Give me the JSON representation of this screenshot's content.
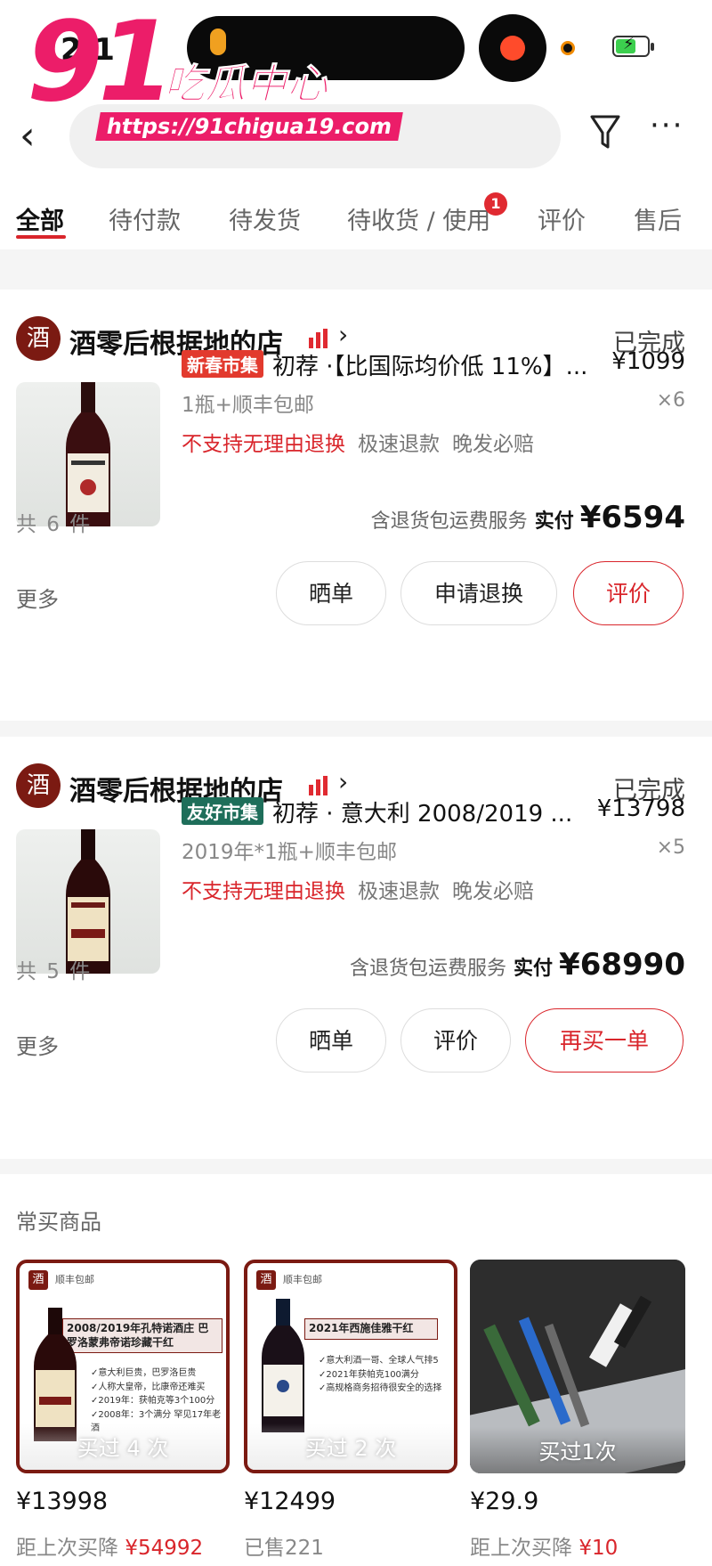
{
  "status_bar": {
    "time": "2:1"
  },
  "watermark": {
    "number": "91",
    "chinese": "吃瓜中心",
    "url": "https://91chigua19.com"
  },
  "nav": {
    "back_icon": "chevron-left-icon",
    "filter_icon": "funnel-icon",
    "more_icon": "ellipsis-icon"
  },
  "tabs": [
    {
      "label": "全部",
      "active": true
    },
    {
      "label": "待付款"
    },
    {
      "label": "待发货"
    },
    {
      "label": "待收货 / 使用",
      "badge": "1"
    },
    {
      "label": "评价"
    },
    {
      "label": "售后"
    }
  ],
  "orders": [
    {
      "shop_logo": "酒",
      "shop_name": "酒零后根据地的店",
      "status": "已完成",
      "tag": "新春市集",
      "tag_color": "#e23a2e",
      "title": "初荐 ·【比国际均价低 11%】...",
      "price": "¥1099",
      "spec": "1瓶+顺丰包邮",
      "qty": "×6",
      "svc_red": "不支持无理由退换",
      "svc_1": "极速退款",
      "svc_2": "晚发必赔",
      "count": "共 6 件",
      "total_note": "含退货包运费服务",
      "total_label": "实付",
      "total_amount": "¥6594",
      "more": "更多",
      "buttons": [
        "晒单",
        "申请退换",
        "评价"
      ]
    },
    {
      "shop_logo": "酒",
      "shop_name": "酒零后根据地的店",
      "status": "已完成",
      "tag": "友好市集",
      "tag_color": "#1e6e5a",
      "title": "初荐 · 意大利 2008/2019 ...",
      "price": "¥13798",
      "spec": "2019年*1瓶+顺丰包邮",
      "qty": "×5",
      "svc_red": "不支持无理由退换",
      "svc_1": "极速退款",
      "svc_2": "晚发必赔",
      "count": "共 5 件",
      "total_note": "含退货包运费服务",
      "total_label": "实付",
      "total_amount": "¥68990",
      "more": "更多",
      "buttons": [
        "晒单",
        "评价",
        "再买一单"
      ]
    }
  ],
  "frequent": {
    "title": "常买商品",
    "items": [
      {
        "logo": "酒",
        "ship": "顺丰包邮",
        "banner": "2008/2019年孔特诺酒庄 巴罗洛蒙弗帝诺珍藏干红",
        "bullets": [
          "✓意大利巨贵，巴罗洛巨贵",
          "✓人称大皇帝，比康帝还难买",
          "✓2019年：获帕克等3个100分",
          "✓2008年：3个满分  罕见17年老酒"
        ],
        "overlay": "买过 4 次",
        "price": "¥13998",
        "sub_label": "距上次买降",
        "sub_value": "¥54992"
      },
      {
        "logo": "酒",
        "ship": "顺丰包邮",
        "banner": "2021年西施佳雅干红",
        "bullets": [
          "✓意大利酒一哥、全球人气排5",
          "✓2021年获帕克100满分",
          "✓高规格商务招待很安全的选择"
        ],
        "overlay": "买过 2 次",
        "price": "¥12499",
        "sub_label": "已售221",
        "sub_value": ""
      },
      {
        "overlay": "买过1次",
        "price": "¥29.9",
        "sub_label": "距上次买降",
        "sub_value": "¥10"
      }
    ]
  }
}
